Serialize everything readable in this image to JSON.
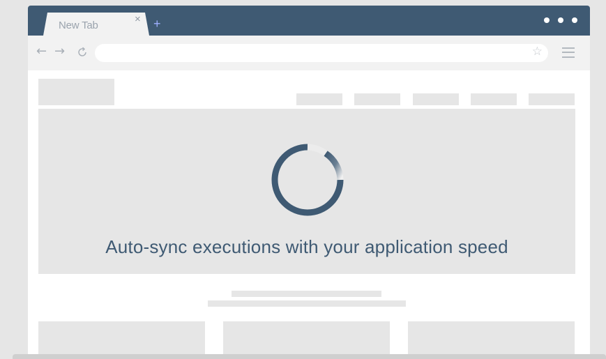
{
  "browser": {
    "tab": {
      "title": "New Tab",
      "close_icon": "×"
    },
    "new_tab_icon": "+",
    "address_value": "",
    "colors": {
      "titlebar": "#3f5a73",
      "accent": "#9fb0ff"
    }
  },
  "hero": {
    "headline": "Auto-sync executions with your application speed",
    "spinner_color": "#3f5a73"
  }
}
